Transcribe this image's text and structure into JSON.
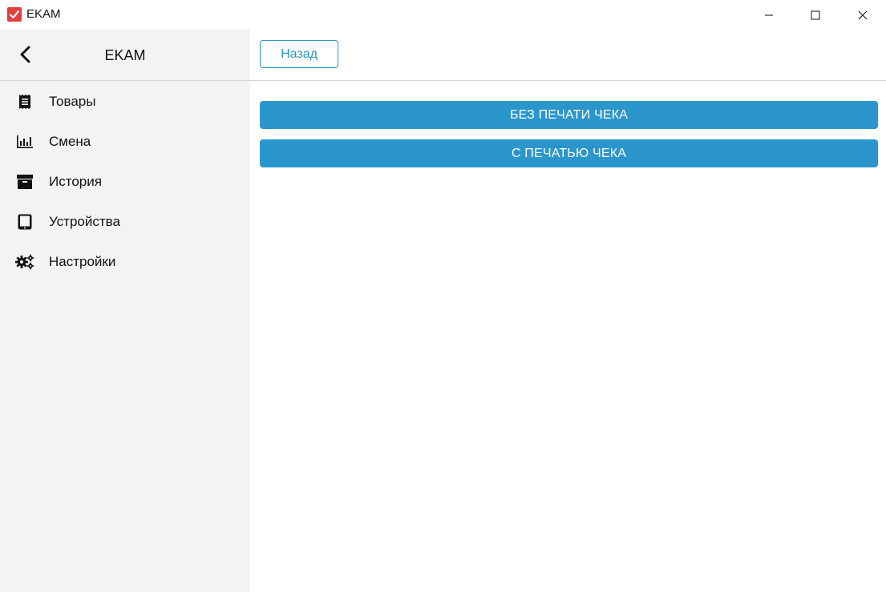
{
  "window": {
    "title": "EKAM",
    "accent_color": "#e43d3d"
  },
  "sidebar": {
    "title": "EKAM",
    "back_icon": "chevron-left-icon",
    "items": [
      {
        "label": "Товары",
        "icon": "receipt-icon"
      },
      {
        "label": "Смена",
        "icon": "bar-chart-icon"
      },
      {
        "label": "История",
        "icon": "archive-icon"
      },
      {
        "label": "Устройства",
        "icon": "tablet-icon"
      },
      {
        "label": "Настройки",
        "icon": "gears-icon"
      }
    ],
    "background": "#f3f3f3"
  },
  "main": {
    "back_label": "Назад",
    "actions": [
      {
        "label": "БЕЗ ПЕЧАТИ ЧЕКА"
      },
      {
        "label": "С ПЕЧАТЬЮ ЧЕКА"
      }
    ],
    "primary_color": "#2b96cc"
  }
}
